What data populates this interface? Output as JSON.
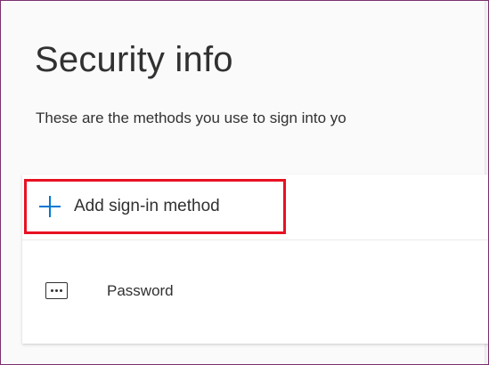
{
  "page": {
    "title": "Security info",
    "subtitle": "These are the methods you use to sign into yo"
  },
  "actions": {
    "add_method_label": "Add sign-in method",
    "add_method_icon": "plus-icon",
    "highlight_color": "#e81123",
    "accent_color": "#0078d4"
  },
  "methods": [
    {
      "icon": "password-icon",
      "label": "Password"
    }
  ]
}
